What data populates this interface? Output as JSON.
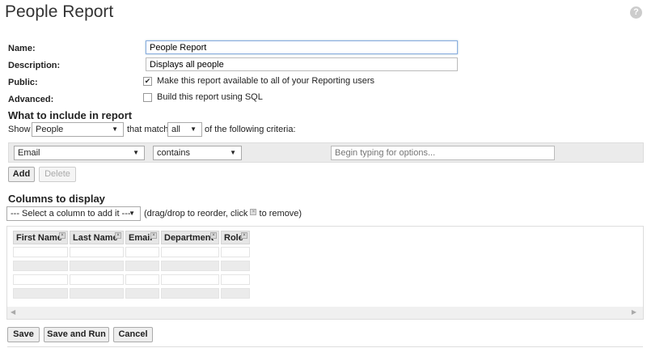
{
  "title": "People Report",
  "help": "?",
  "form": {
    "name_label": "Name:",
    "name_value": "People Report",
    "description_label": "Description:",
    "description_value": "Displays all people",
    "public_label": "Public:",
    "public_text": "Make this report available to all of your Reporting users",
    "public_checked": true,
    "advanced_label": "Advanced:",
    "advanced_text": "Build this report using SQL",
    "advanced_checked": false
  },
  "criteria": {
    "heading": "What to include in report",
    "show": "Show",
    "show_value": "People",
    "that_match": "that match",
    "match_value": "all",
    "following": "of the following criteria:",
    "field": "Email",
    "operator": "contains",
    "value_placeholder": "Begin typing for options...",
    "add": "Add",
    "delete": "Delete"
  },
  "columns": {
    "heading": "Columns to display",
    "select": "--- Select a column to add it ---",
    "hint_pre": "(drag/drop to reorder, click",
    "hint_post": "to remove)",
    "headers": [
      "First Name",
      "Last Name",
      "Email",
      "Department",
      "Role"
    ]
  },
  "actions": {
    "save": "Save",
    "save_run": "Save and Run",
    "cancel": "Cancel"
  }
}
